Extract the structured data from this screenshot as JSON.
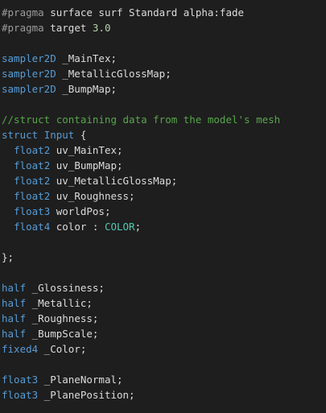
{
  "colors": {
    "background": "#1e1e1e",
    "plain": "#dcdcdc",
    "keyword": "#569cd6",
    "directive": "#9b9b9b",
    "comment": "#57a64a",
    "semantic": "#4ec9b0",
    "number": "#b5cea8"
  },
  "lines": [
    [
      {
        "t": "directive",
        "v": "#pragma"
      },
      {
        "t": "plain",
        "v": " surface surf Standard alpha:fade"
      }
    ],
    [
      {
        "t": "directive",
        "v": "#pragma"
      },
      {
        "t": "plain",
        "v": " target "
      },
      {
        "t": "number",
        "v": "3.0"
      }
    ],
    [],
    [
      {
        "t": "keyword",
        "v": "sampler2D"
      },
      {
        "t": "plain",
        "v": " _MainTex;"
      }
    ],
    [
      {
        "t": "keyword",
        "v": "sampler2D"
      },
      {
        "t": "plain",
        "v": " _MetallicGlossMap;"
      }
    ],
    [
      {
        "t": "keyword",
        "v": "sampler2D"
      },
      {
        "t": "plain",
        "v": " _BumpMap;"
      }
    ],
    [],
    [
      {
        "t": "comment",
        "v": "//struct containing data from the model's mesh"
      }
    ],
    [
      {
        "t": "keyword",
        "v": "struct"
      },
      {
        "t": "plain",
        "v": " "
      },
      {
        "t": "keyword",
        "v": "Input"
      },
      {
        "t": "plain",
        "v": " {"
      }
    ],
    [
      {
        "t": "plain",
        "v": "  "
      },
      {
        "t": "keyword",
        "v": "float2"
      },
      {
        "t": "plain",
        "v": " uv_MainTex;"
      }
    ],
    [
      {
        "t": "plain",
        "v": "  "
      },
      {
        "t": "keyword",
        "v": "float2"
      },
      {
        "t": "plain",
        "v": " uv_BumpMap;"
      }
    ],
    [
      {
        "t": "plain",
        "v": "  "
      },
      {
        "t": "keyword",
        "v": "float2"
      },
      {
        "t": "plain",
        "v": " uv_MetallicGlossMap;"
      }
    ],
    [
      {
        "t": "plain",
        "v": "  "
      },
      {
        "t": "keyword",
        "v": "float2"
      },
      {
        "t": "plain",
        "v": " uv_Roughness;"
      }
    ],
    [
      {
        "t": "plain",
        "v": "  "
      },
      {
        "t": "keyword",
        "v": "float3"
      },
      {
        "t": "plain",
        "v": " worldPos;"
      }
    ],
    [
      {
        "t": "plain",
        "v": "  "
      },
      {
        "t": "keyword",
        "v": "float4"
      },
      {
        "t": "plain",
        "v": " color : "
      },
      {
        "t": "semantic",
        "v": "COLOR"
      },
      {
        "t": "plain",
        "v": ";"
      }
    ],
    [],
    [
      {
        "t": "plain",
        "v": "};"
      }
    ],
    [],
    [
      {
        "t": "keyword",
        "v": "half"
      },
      {
        "t": "plain",
        "v": " _Glossiness;"
      }
    ],
    [
      {
        "t": "keyword",
        "v": "half"
      },
      {
        "t": "plain",
        "v": " _Metallic;"
      }
    ],
    [
      {
        "t": "keyword",
        "v": "half"
      },
      {
        "t": "plain",
        "v": " _Roughness;"
      }
    ],
    [
      {
        "t": "keyword",
        "v": "half"
      },
      {
        "t": "plain",
        "v": " _BumpScale;"
      }
    ],
    [
      {
        "t": "keyword",
        "v": "fixed4"
      },
      {
        "t": "plain",
        "v": " _Color;"
      }
    ],
    [],
    [
      {
        "t": "keyword",
        "v": "float3"
      },
      {
        "t": "plain",
        "v": " _PlaneNormal;"
      }
    ],
    [
      {
        "t": "keyword",
        "v": "float3"
      },
      {
        "t": "plain",
        "v": " _PlanePosition;"
      }
    ]
  ]
}
